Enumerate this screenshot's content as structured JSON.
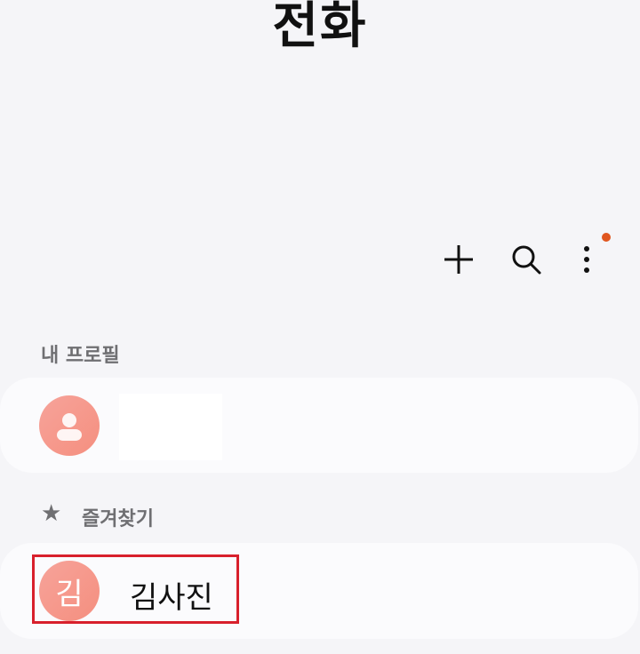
{
  "header": {
    "title": "전화"
  },
  "toolbar": {
    "add_icon": "plus-icon",
    "search_icon": "search-icon",
    "more_icon": "more-vert-icon"
  },
  "colors": {
    "background": "#f5f5f8",
    "card": "#fbfbfd",
    "avatar": "#f58f7f",
    "notification": "#e0561f",
    "highlight": "#d8202c"
  },
  "profile": {
    "section_label": "내 프로필"
  },
  "favorites": {
    "section_label": "즐겨찾기",
    "items": [
      {
        "initial": "김",
        "name": "김사진"
      }
    ]
  }
}
